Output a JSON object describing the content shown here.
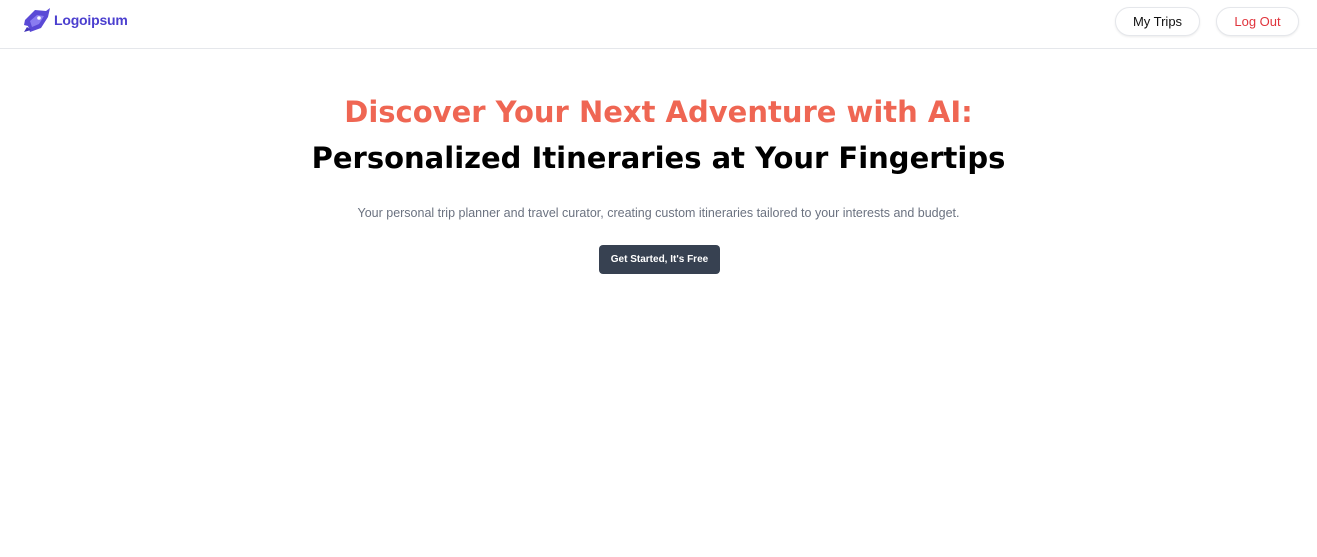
{
  "brand": {
    "name": "Logoipsum",
    "icon": "logo-mark-icon",
    "color": "#4b3fcf"
  },
  "nav": {
    "my_trips_label": "My Trips",
    "logout_label": "Log Out",
    "logout_color": "#e0343c"
  },
  "hero": {
    "headline_accent": "Discover Your Next Adventure with AI:",
    "headline_main": "Personalized Itineraries at Your Fingertips",
    "subtitle": "Your personal trip planner and travel curator, creating custom itineraries tailored to your interests and budget.",
    "cta_label": "Get Started, It's Free",
    "accent_color": "#ef6653",
    "cta_color": "#374151"
  }
}
